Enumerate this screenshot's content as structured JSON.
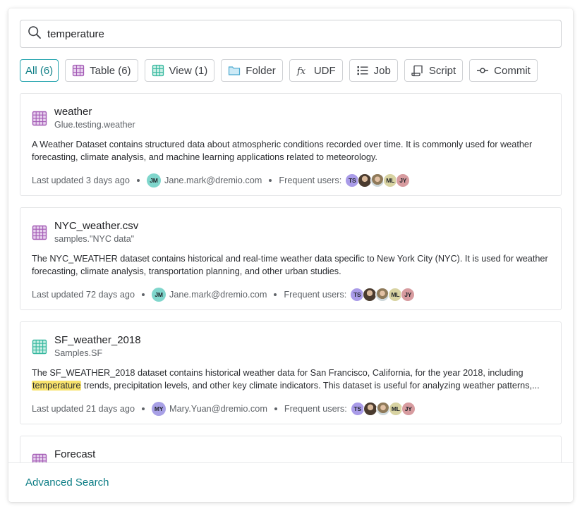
{
  "search": {
    "value": "temperature"
  },
  "filters": [
    {
      "label": "All (6)",
      "icon": "none"
    },
    {
      "label": "Table (6)",
      "icon": "table-icon"
    },
    {
      "label": "View (1)",
      "icon": "view-icon"
    },
    {
      "label": "Folder",
      "icon": "folder-icon"
    },
    {
      "label": "UDF",
      "icon": "function-icon"
    },
    {
      "label": "Job",
      "icon": "job-list-icon"
    },
    {
      "label": "Script",
      "icon": "script-icon"
    },
    {
      "label": "Commit",
      "icon": "commit-icon"
    }
  ],
  "results": [
    {
      "type": "table",
      "title": "weather",
      "path": "Glue.testing.weather",
      "description": "A Weather Dataset contains structured data about atmospheric conditions recorded over time. It is commonly used for weather forecasting, climate analysis, and machine learning applications related to meteorology.",
      "updated": "Last updated 3 days ago",
      "owner": {
        "initials": "JM",
        "email": "Jane.mark@dremio.com"
      },
      "frequent_label": "Frequent users:"
    },
    {
      "type": "table",
      "title": "NYC_weather.csv",
      "path": "samples.\"NYC data\"",
      "description": "The NYC_WEATHER dataset contains historical and real-time weather data specific to New York City (NYC). It is used for weather forecasting, climate analysis, transportation planning, and other urban studies.",
      "updated": "Last updated 72 days ago",
      "owner": {
        "initials": "JM",
        "email": "Jane.mark@dremio.com"
      },
      "frequent_label": "Frequent users:"
    },
    {
      "type": "view",
      "title": "SF_weather_2018",
      "path": "Samples.SF",
      "desc_before": "The SF_WEATHER_2018 dataset contains historical weather data for San Francisco, California, for the year 2018, including ",
      "desc_highlight": "temperature",
      "desc_after": " trends, precipitation levels, and other key climate indicators. This dataset is useful for analyzing weather patterns,...",
      "updated": "Last updated 21 days ago",
      "owner": {
        "initials": "MY",
        "email": "Mary.Yuan@dremio.com"
      },
      "frequent_label": "Frequent users:"
    },
    {
      "type": "table",
      "title": "Forecast"
    }
  ],
  "frequent_users": [
    {
      "initials": "TS",
      "color": "#a99be8"
    },
    {
      "initials": "",
      "color": "photo"
    },
    {
      "initials": "",
      "color": "photo2"
    },
    {
      "initials": "ML",
      "color": "#d8d3a2"
    },
    {
      "initials": "JY",
      "color": "#d79b9f"
    }
  ],
  "colors": {
    "accent": "#0e7e86",
    "table_icon": "#a45bb5",
    "view_icon": "#36b89f",
    "highlight": "#f8e36d",
    "owner_jm": "#7fd6cc",
    "owner_my": "#a8a0e6"
  },
  "footer": {
    "link": "Advanced Search"
  }
}
